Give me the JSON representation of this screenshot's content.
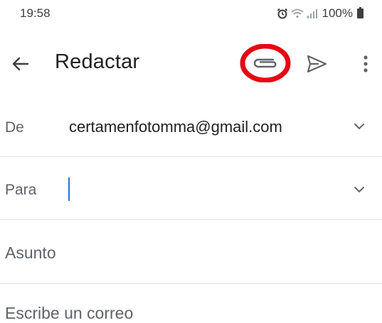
{
  "status_bar": {
    "time": "19:58",
    "battery": "100%",
    "icons": [
      "alarm-icon",
      "wifi-icon",
      "signal-icon",
      "battery-icon"
    ]
  },
  "app_bar": {
    "title": "Redactar",
    "back_icon": "arrow-left-icon",
    "attach_icon": "paperclip-icon",
    "send_icon": "send-icon",
    "more_icon": "more-vertical-icon",
    "highlight_color": "#e50914"
  },
  "compose": {
    "from_label": "De",
    "from_value": "certamenfotomma@gmail.com",
    "to_label": "Para",
    "to_value": "",
    "subject_placeholder": "Asunto",
    "body_placeholder": "Escribe un correo"
  },
  "colors": {
    "caret": "#1a73e8",
    "text": "#202124",
    "secondary": "#5f6368"
  }
}
